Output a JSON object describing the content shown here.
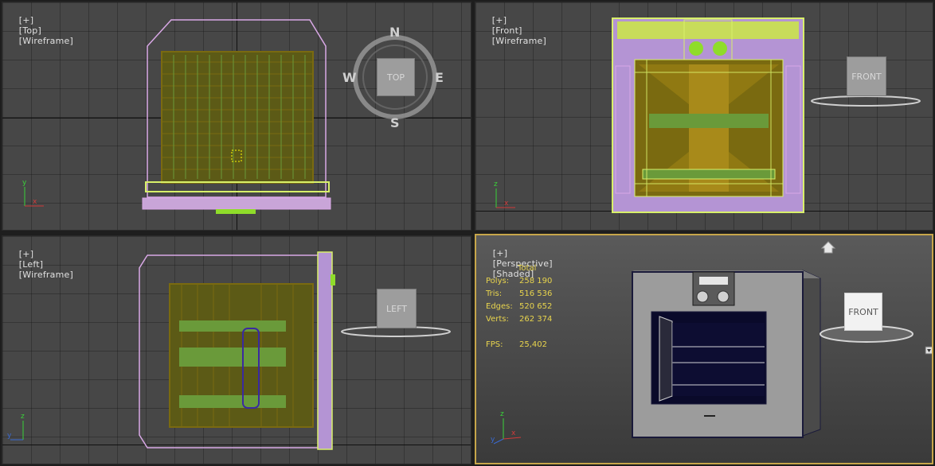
{
  "viewports": {
    "top": {
      "plus": "[+]",
      "view": "[Top]",
      "mode": "[Wireframe]"
    },
    "front": {
      "plus": "[+]",
      "view": "[Front]",
      "mode": "[Wireframe]"
    },
    "left": {
      "plus": "[+]",
      "view": "[Left]",
      "mode": "[Wireframe]"
    },
    "persp": {
      "plus": "[+]",
      "view": "[Perspective]",
      "mode": "[Shaded]"
    }
  },
  "compass": {
    "n": "N",
    "s": "S",
    "e": "E",
    "w": "W"
  },
  "viewcube": {
    "top": "TOP",
    "front": "FRONT",
    "left": "LEFT",
    "persp": "FRONT"
  },
  "axes": {
    "x": "x",
    "y": "y",
    "z": "z"
  },
  "stats": {
    "header": "Total",
    "polys_label": "Polys:",
    "polys": "258 190",
    "tris_label": "Tris:",
    "tris": "516 536",
    "edges_label": "Edges:",
    "edges": "520 652",
    "verts_label": "Verts:",
    "verts": "262 374",
    "fps_label": "FPS:",
    "fps": "25,402"
  },
  "colors": {
    "wire_pink": "#d9a8e6",
    "wire_yellow": "#d8f06a",
    "wire_olive": "#7a6a10",
    "wire_green": "#6a9a3a",
    "accent": "#c7a64a"
  }
}
